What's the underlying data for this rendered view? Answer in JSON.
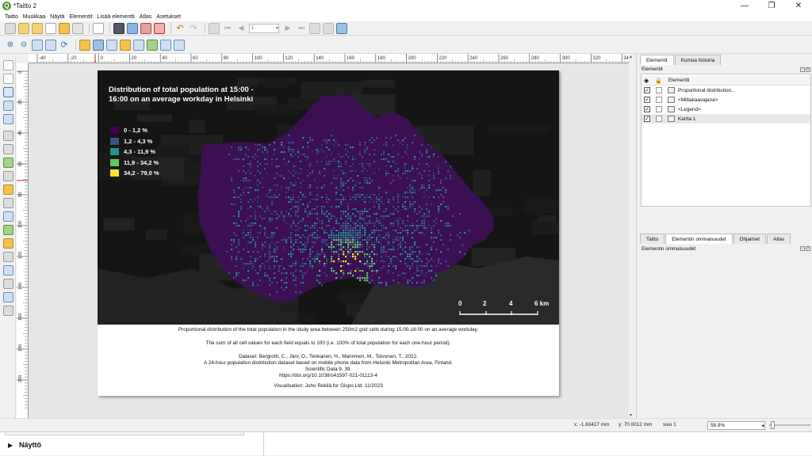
{
  "window": {
    "title": "*Taitto 2",
    "minimize": "—",
    "maximize": "❐",
    "close": "✕"
  },
  "menu": [
    "Taitto",
    "Muokkaa",
    "Näytä",
    "Elementit",
    "Lisää elementti",
    "Atlas",
    "Asetukset"
  ],
  "toolbar": {
    "page_value": "1"
  },
  "ruler": {
    "h_labels": [
      "-40",
      "-20",
      "0",
      "20",
      "40",
      "60",
      "80",
      "100",
      "120",
      "140",
      "160",
      "180",
      "200",
      "220",
      "240",
      "260",
      "280",
      "300",
      "320",
      "340"
    ],
    "v_labels": [
      "0",
      "20",
      "40",
      "60",
      "80",
      "100",
      "120",
      "140",
      "160",
      "180",
      "200"
    ]
  },
  "map": {
    "title": "Distribution of total population at 15:00 - 16:00 on an average workday in Helsinki",
    "legend": [
      {
        "label": "0 - 1,2 %",
        "color": "#440154"
      },
      {
        "label": "1,2 - 4,3 %",
        "color": "#3b528b"
      },
      {
        "label": "4,3 - 11,9 %",
        "color": "#21918c"
      },
      {
        "label": "11,9 - 34,2 %",
        "color": "#5ec962"
      },
      {
        "label": "34,2 - 79,0 %",
        "color": "#fde725"
      }
    ],
    "scale_labels": [
      "0",
      "2",
      "4",
      "6 km"
    ],
    "region_color": "#3b0f52"
  },
  "caption": {
    "line1": "Proportional distribution of the total population in the study area between 250m2 grid cells during 15:00-16:00 on an average workday.",
    "line2": "The sum of all cell values for each field equals to 100 (i.e. 100% of total population for each one-hour period).",
    "dataset1": "Dataset: Bergroth, C., Järv, O., Tenkanen, H., Manninen, M., Toivonen, T., 2022.",
    "dataset2": "A 24-hour population distribution dataset based on mobile phone data from Helsinki Metropolitan Area, Finland.",
    "dataset3": "Scientific Data 9, 39.",
    "doi": "https://doi.org/10.1038/s41597-021-01113-4",
    "visualisation": "Visualisation: Juho Rekilä for Gispo Ltd. 11/2023"
  },
  "status": {
    "x": "x: -1.63427 mm",
    "y": "y: 70.0012 mm",
    "page": "sivu 1",
    "zoom": "58.9%"
  },
  "dock": {
    "label": "Näyttö"
  },
  "right_panel": {
    "top_tabs": [
      "Elementit",
      "Kumoa historia"
    ],
    "items_header": "Elementit",
    "column_header": "Elementti",
    "items": [
      {
        "name": "Proportional distribution...",
        "checked": "✓"
      },
      {
        "name": "<Mittakaavajana>",
        "checked": "✓"
      },
      {
        "name": "<Legend>",
        "checked": "✓"
      },
      {
        "name": "Kartta 1",
        "checked": "✓"
      }
    ],
    "bottom_tabs": [
      "Taitto",
      "Elementin ominaisuudet",
      "Ohjaimet",
      "Atlas"
    ],
    "properties_header": "Elementin ominaisuudet"
  },
  "colors": {
    "qgis_green": "#589632",
    "accent_red": "#d02020"
  }
}
